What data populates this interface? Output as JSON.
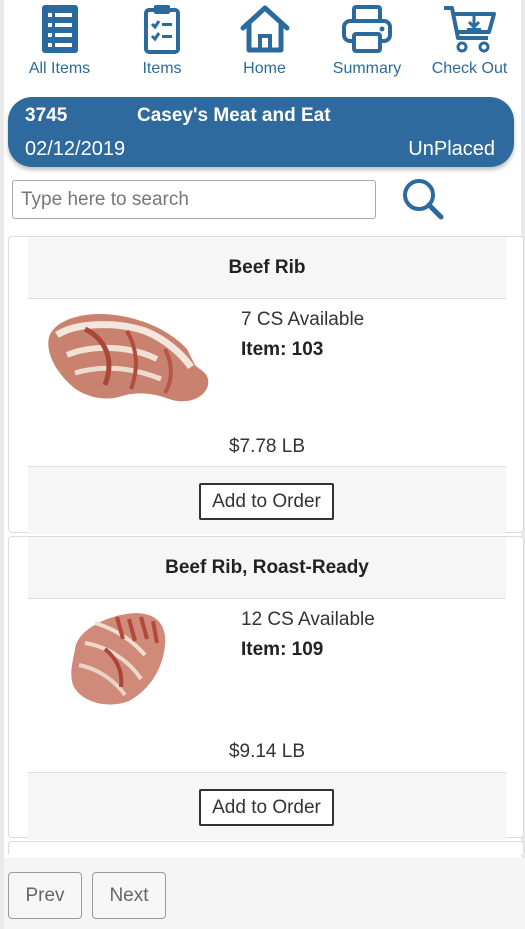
{
  "nav": {
    "items": [
      {
        "label": "All Items",
        "icon": "list-icon"
      },
      {
        "label": "Items",
        "icon": "clipboard-check-icon"
      },
      {
        "label": "Home",
        "icon": "home-icon"
      },
      {
        "label": "Summary",
        "icon": "printer-icon"
      },
      {
        "label": "Check Out",
        "icon": "cart-download-icon"
      }
    ]
  },
  "order": {
    "number": "3745",
    "customer": "Casey's Meat and Eat",
    "date": "02/12/2019",
    "status": "UnPlaced"
  },
  "search": {
    "placeholder": "Type here to search",
    "value": ""
  },
  "products": [
    {
      "name": "Beef Rib",
      "availability": "7 CS Available",
      "item": "Item: 103",
      "price": "$7.78 LB",
      "button": "Add to Order"
    },
    {
      "name": "Beef Rib, Roast-Ready",
      "availability": "12 CS Available",
      "item": "Item: 109",
      "price": "$9.14 LB",
      "button": "Add to Order"
    }
  ],
  "pager": {
    "prev": "Prev",
    "next": "Next"
  },
  "colors": {
    "brand": "#2e6a9e",
    "text": "#222222",
    "muted": "#666666"
  }
}
